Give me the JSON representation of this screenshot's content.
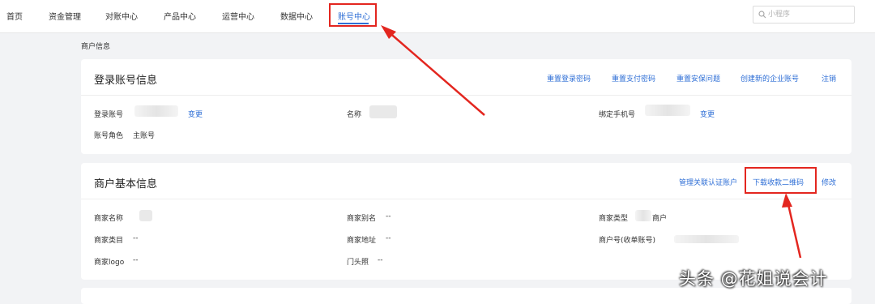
{
  "nav": {
    "items": [
      {
        "label": "首页"
      },
      {
        "label": "资金管理"
      },
      {
        "label": "对账中心"
      },
      {
        "label": "产品中心"
      },
      {
        "label": "运营中心"
      },
      {
        "label": "数据中心"
      },
      {
        "label": "账号中心"
      }
    ],
    "active_index": 6,
    "search_placeholder": "小程序"
  },
  "page_label": "商户信息",
  "login_card": {
    "title": "登录账号信息",
    "actions": [
      "重置登录密码",
      "重置支付密码",
      "重置安保问题",
      "创建新的企业账号",
      "注销"
    ],
    "login_account_label": "登录账号",
    "login_account_change": "变更",
    "name_label": "名称",
    "phone_label": "绑定手机号",
    "phone_change": "变更",
    "role_label": "账号角色",
    "role_value": "主账号"
  },
  "merchant_card": {
    "title": "商户基本信息",
    "actions": [
      "管理关联认证账户",
      "下载收款二维码",
      "修改"
    ],
    "name_label": "商家名称",
    "alias_label": "商家别名",
    "alias_value": "--",
    "type_label": "商家类型",
    "type_value": "商户",
    "category_label": "商家类目",
    "category_value": "--",
    "address_label": "商家地址",
    "address_value": "--",
    "account_no_label": "商户号(收单账号)",
    "logo_label": "商家logo",
    "logo_value": "--",
    "storefront_label": "门头照",
    "storefront_value": "--"
  },
  "watermark": "头条 @花姐说会计",
  "colors": {
    "accent": "#2f6fd6",
    "annotation": "#e3261f",
    "background": "#f2f3f5"
  }
}
